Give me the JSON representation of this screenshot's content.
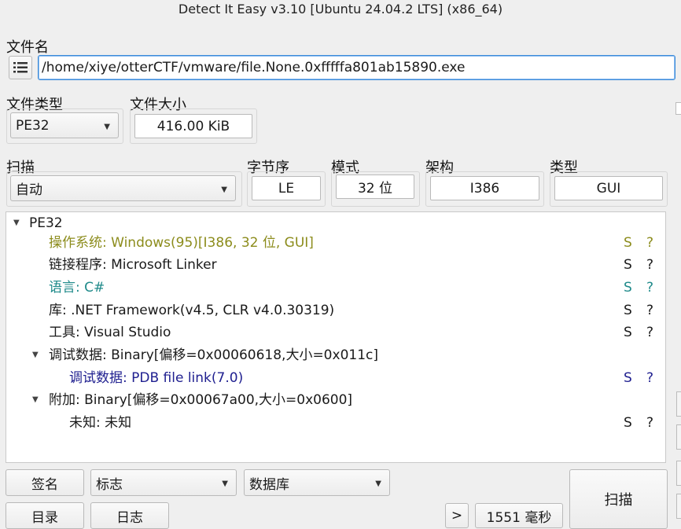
{
  "window": {
    "title": "Detect It Easy v3.10 [Ubuntu 24.04.2 LTS] (x86_64)"
  },
  "file": {
    "label": "文件名",
    "path": "/home/xiye/otterCTF/vmware/file.None.0xfffffa801ab15890.exe"
  },
  "file_type": {
    "label": "文件类型",
    "value": "PE32"
  },
  "file_size": {
    "label": "文件大小",
    "value": "416.00 KiB"
  },
  "scan": {
    "label": "扫描",
    "value": "自动"
  },
  "endianness": {
    "label": "字节序",
    "value": "LE"
  },
  "mode": {
    "label": "模式",
    "value": "32 位"
  },
  "arch": {
    "label": "架构",
    "value": "I386"
  },
  "type": {
    "label": "类型",
    "value": "GUI"
  },
  "results": {
    "root": "PE32",
    "items": [
      {
        "text": "操作系统: Windows(95)[I386, 32 位, GUI]",
        "s": "S",
        "q": "?",
        "color": "#8c8c1c"
      },
      {
        "text": "链接程序: Microsoft Linker",
        "s": "S",
        "q": "?",
        "color": "#1a1a1a"
      },
      {
        "text": "语言: C#",
        "s": "S",
        "q": "?",
        "color": "#1f8a8a"
      },
      {
        "text": "库: .NET Framework(v4.5, CLR v4.0.30319)",
        "s": "S",
        "q": "?",
        "color": "#1a1a1a"
      },
      {
        "text": "工具: Visual Studio",
        "s": "S",
        "q": "?",
        "color": "#1a1a1a"
      },
      {
        "text": "调试数据: Binary[偏移=0x00060618,大小=0x011c]",
        "color": "#1a1a1a"
      },
      {
        "text": "调试数据: PDB file link(7.0)",
        "s": "S",
        "q": "?",
        "color": "#202090"
      },
      {
        "text": "附加: Binary[偏移=0x00067a00,大小=0x0600]",
        "color": "#1a1a1a"
      },
      {
        "text": "未知: 未知",
        "s": "S",
        "q": "?",
        "color": "#1a1a1a"
      }
    ]
  },
  "bottom": {
    "signatures": "签名",
    "flags": "标志",
    "database": "数据库",
    "directory": "目录",
    "log": "日志",
    "more": ">",
    "elapsed": "1551 毫秒",
    "scan_button": "扫描"
  },
  "icons": {
    "menu": "menu-icon",
    "expand": "expand-arrow-icon",
    "dropdown": "chevron-down-icon"
  }
}
